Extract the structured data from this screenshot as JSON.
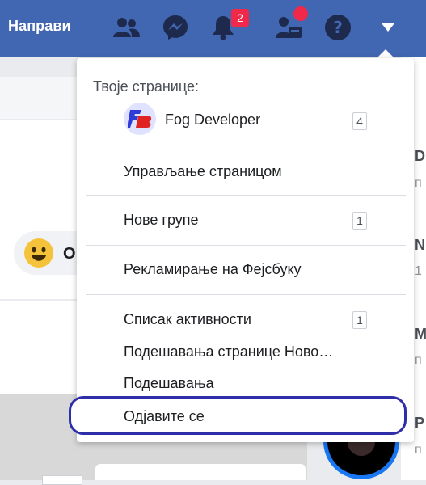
{
  "topbar": {
    "create_label": "Направи",
    "notifications_count": "2"
  },
  "menu": {
    "header": "Твоје странице:",
    "page_name": "Fog Developer",
    "page_count": "4",
    "manage_page": "Управљање страницом",
    "new_groups": "Нове групе",
    "new_groups_count": "1",
    "advertise": "Рекламирање на Фејсбуку",
    "activity_log": "Списак активности",
    "activity_count": "1",
    "news_feed_prefs": "Подешавања странице Ново…",
    "settings": "Подешавања",
    "logout": "Одјавите се"
  },
  "background": {
    "emoji_text": "О",
    "right_letters": [
      "D",
      "п",
      "N",
      "1",
      "M",
      "п",
      "P",
      "п"
    ]
  },
  "colors": {
    "bar": "#4267b2",
    "badge": "#f02849",
    "highlight_ring": "#2e2fa8"
  }
}
